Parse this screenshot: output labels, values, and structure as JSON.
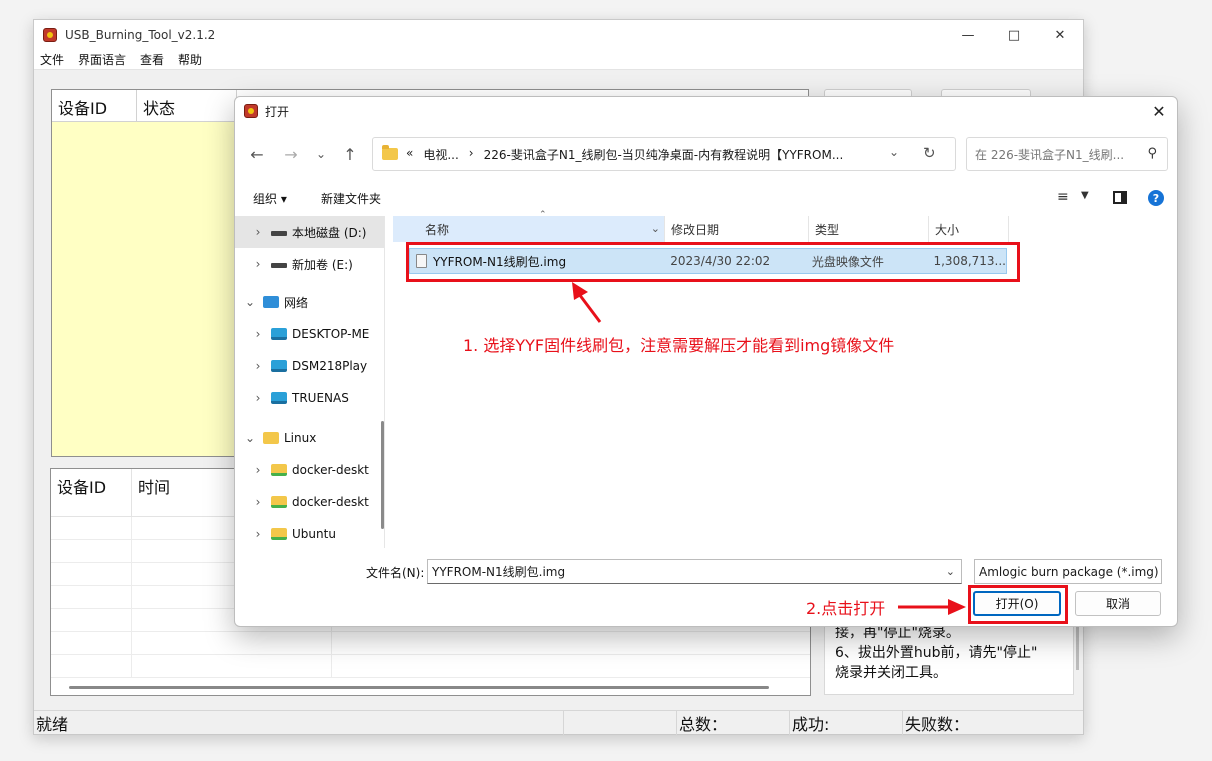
{
  "tool": {
    "title": "USB_Burning_Tool_v2.1.2",
    "menu": [
      "文件",
      "界面语言",
      "查看",
      "帮助"
    ],
    "device_table": {
      "columns": [
        "设备ID",
        "状态"
      ]
    },
    "log_table": {
      "columns": [
        "设备ID",
        "时间"
      ]
    },
    "notes": [
      "接，再\"停止\"烧录。",
      "6、拔出外置hub前，请先\"停止\"",
      "烧录并关闭工具。"
    ],
    "status": {
      "ready": "就绪",
      "total": "总数：",
      "success": "成功:",
      "fail": "失败数："
    }
  },
  "dialog": {
    "title": "打开",
    "address": {
      "parts": [
        "«",
        "电视...",
        "›",
        "226-斐讯盒子N1_线刷包-当贝纯净桌面-内有教程说明【YYFROM..."
      ]
    },
    "search_placeholder": "在 226-斐讯盒子N1_线刷...",
    "toolbar": {
      "organize": "组织 ▾",
      "new_folder": "新建文件夹"
    },
    "sidebar": [
      {
        "label": "本地磁盘 (D:)",
        "icon": "drive-icon",
        "selected": true,
        "indent": 1
      },
      {
        "label": "新加卷 (E:)",
        "icon": "drive-icon",
        "indent": 1
      },
      {
        "label": "网络",
        "icon": "network-icon",
        "expanded": true,
        "indent": 0
      },
      {
        "label": "DESKTOP-ME",
        "icon": "computer-icon",
        "indent": 1
      },
      {
        "label": "DSM218Play",
        "icon": "computer-icon",
        "indent": 1
      },
      {
        "label": "TRUENAS",
        "icon": "computer-icon",
        "indent": 1
      },
      {
        "label": "Linux",
        "icon": "folder-icon",
        "expanded": true,
        "indent": 0
      },
      {
        "label": "docker-deskt",
        "icon": "folder-icon",
        "indent": 1
      },
      {
        "label": "docker-deskt",
        "icon": "folder-icon",
        "indent": 1
      },
      {
        "label": "Ubuntu",
        "icon": "folder-icon",
        "indent": 1
      }
    ],
    "columns": {
      "name": "名称",
      "date": "修改日期",
      "type": "类型",
      "size": "大小"
    },
    "file": {
      "name": "YYFROM-N1线刷包.img",
      "date": "2023/4/30 22:02",
      "type": "光盘映像文件",
      "size": "1,308,713..."
    },
    "filename_label": "文件名(N):",
    "filename_value": "YYFROM-N1线刷包.img",
    "filetype": "Amlogic burn package (*.img)",
    "open_button": "打开(O)",
    "cancel_button": "取消"
  },
  "annotations": {
    "step1": "1. 选择YYF固件线刷包，注意需要解压才能看到img镜像文件",
    "step2": "2.点击打开",
    "color": "#e8101a"
  }
}
